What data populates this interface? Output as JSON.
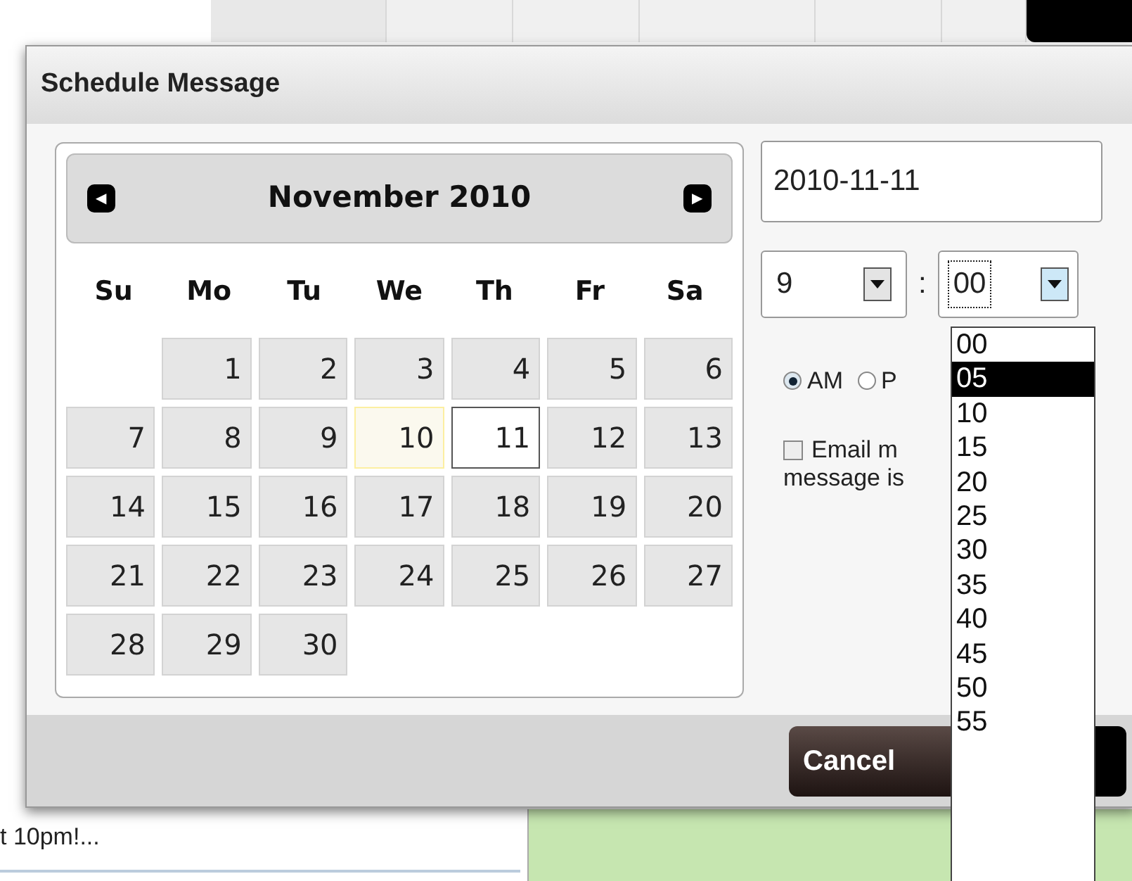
{
  "background": {
    "bottom_left_text": "t 10pm!..."
  },
  "dialog": {
    "title": "Schedule Message",
    "calendar": {
      "month": "November 2010",
      "prev": "◀",
      "next": "▶",
      "weekdays": [
        "Su",
        "Mo",
        "Tu",
        "We",
        "Th",
        "Fr",
        "Sa"
      ],
      "days": [
        {
          "kind": "empty"
        },
        {
          "day": "1",
          "today": false,
          "selected": false
        },
        {
          "day": "2",
          "today": false,
          "selected": false
        },
        {
          "day": "3",
          "today": false,
          "selected": false
        },
        {
          "day": "4",
          "today": false,
          "selected": false
        },
        {
          "day": "5",
          "today": false,
          "selected": false
        },
        {
          "day": "6",
          "today": false,
          "selected": false
        },
        {
          "day": "7",
          "today": false,
          "selected": false
        },
        {
          "day": "8",
          "today": false,
          "selected": false
        },
        {
          "day": "9",
          "today": false,
          "selected": false
        },
        {
          "day": "10",
          "today": true,
          "selected": false
        },
        {
          "day": "11",
          "today": false,
          "selected": true
        },
        {
          "day": "12",
          "today": false,
          "selected": false
        },
        {
          "day": "13",
          "today": false,
          "selected": false
        },
        {
          "day": "14",
          "today": false,
          "selected": false
        },
        {
          "day": "15",
          "today": false,
          "selected": false
        },
        {
          "day": "16",
          "today": false,
          "selected": false
        },
        {
          "day": "17",
          "today": false,
          "selected": false
        },
        {
          "day": "18",
          "today": false,
          "selected": false
        },
        {
          "day": "19",
          "today": false,
          "selected": false
        },
        {
          "day": "20",
          "today": false,
          "selected": false
        },
        {
          "day": "21",
          "today": false,
          "selected": false
        },
        {
          "day": "22",
          "today": false,
          "selected": false
        },
        {
          "day": "23",
          "today": false,
          "selected": false
        },
        {
          "day": "24",
          "today": false,
          "selected": false
        },
        {
          "day": "25",
          "today": false,
          "selected": false
        },
        {
          "day": "26",
          "today": false,
          "selected": false
        },
        {
          "day": "27",
          "today": false,
          "selected": false
        },
        {
          "day": "28",
          "today": false,
          "selected": false
        },
        {
          "day": "29",
          "today": false,
          "selected": false
        },
        {
          "day": "30",
          "today": false,
          "selected": false
        }
      ]
    },
    "date_field": {
      "value": "2010-11-11"
    },
    "hour_select": {
      "value": "9"
    },
    "separator": ":",
    "minute_select": {
      "value": "00",
      "expanded": true,
      "options": [
        {
          "label": "00",
          "highlighted": false
        },
        {
          "label": "05",
          "highlighted": true
        },
        {
          "label": "10",
          "highlighted": false
        },
        {
          "label": "15",
          "highlighted": false
        },
        {
          "label": "20",
          "highlighted": false
        },
        {
          "label": "25",
          "highlighted": false
        },
        {
          "label": "30",
          "highlighted": false
        },
        {
          "label": "35",
          "highlighted": false
        },
        {
          "label": "40",
          "highlighted": false
        },
        {
          "label": "45",
          "highlighted": false
        },
        {
          "label": "50",
          "highlighted": false
        },
        {
          "label": "55",
          "highlighted": false
        }
      ]
    },
    "ampm": [
      {
        "label": "AM",
        "selected": true
      },
      {
        "label": "P",
        "selected": false
      }
    ],
    "email_checkbox": {
      "checked": false,
      "lines": [
        "Email m",
        "message is"
      ]
    },
    "buttons": [
      {
        "label": "Cancel"
      }
    ]
  }
}
